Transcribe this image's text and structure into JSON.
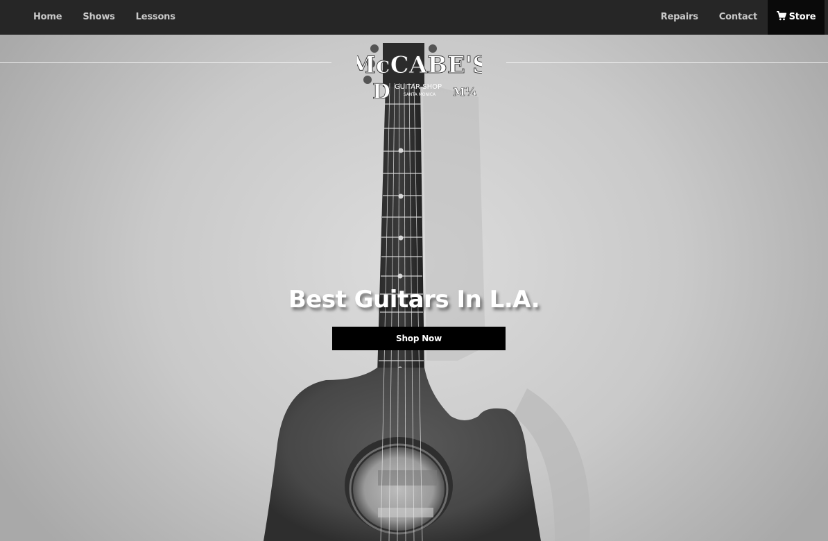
{
  "nav": {
    "left_items": [
      {
        "label": "Home"
      },
      {
        "label": "Shows"
      },
      {
        "label": "Lessons"
      }
    ],
    "right_items": [
      {
        "label": "Repairs"
      },
      {
        "label": "Contact"
      }
    ],
    "store": {
      "label": "Store",
      "icon": "cart-icon"
    }
  },
  "logo": {
    "name": "McCABE'S",
    "subtitle": "GUITAR SHOP",
    "location": "SANTA MONICA",
    "monogram": "M¼",
    "registered": "®"
  },
  "hero": {
    "title": "Best Guitars In L.A.",
    "cta_label": "Shop Now"
  },
  "colors": {
    "nav_bg": "#262626",
    "nav_text": "#c9c9c9",
    "store_bg": "#0a0a0a",
    "button_bg": "#000000",
    "text_white": "#ffffff"
  }
}
